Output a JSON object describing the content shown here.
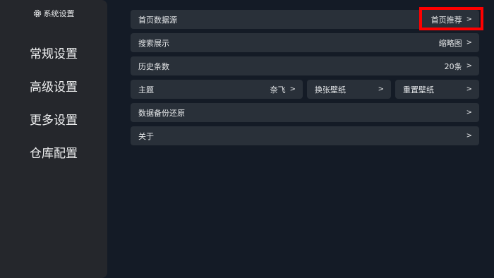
{
  "sidebar": {
    "title": "系统设置",
    "title_icon": "gear-icon",
    "items": [
      {
        "label": "常规设置"
      },
      {
        "label": "高级设置"
      },
      {
        "label": "更多设置"
      },
      {
        "label": "仓库配置"
      }
    ]
  },
  "settings": {
    "homepage_source": {
      "label": "首页数据源",
      "value": "首页推荐"
    },
    "search_display": {
      "label": "搜索展示",
      "value": "缩略图"
    },
    "history_count": {
      "label": "历史条数",
      "value": "20条"
    },
    "theme": {
      "label": "主题",
      "value": "奈飞"
    },
    "change_wallpaper": {
      "label": "换张壁纸"
    },
    "reset_wallpaper": {
      "label": "重置壁纸"
    },
    "backup_restore": {
      "label": "数据备份还原"
    },
    "about": {
      "label": "关于"
    },
    "arrow": ">"
  },
  "colors": {
    "background": "#141b26",
    "sidebar": "#25272c",
    "row": "#293039",
    "highlight": "#ff0000"
  }
}
